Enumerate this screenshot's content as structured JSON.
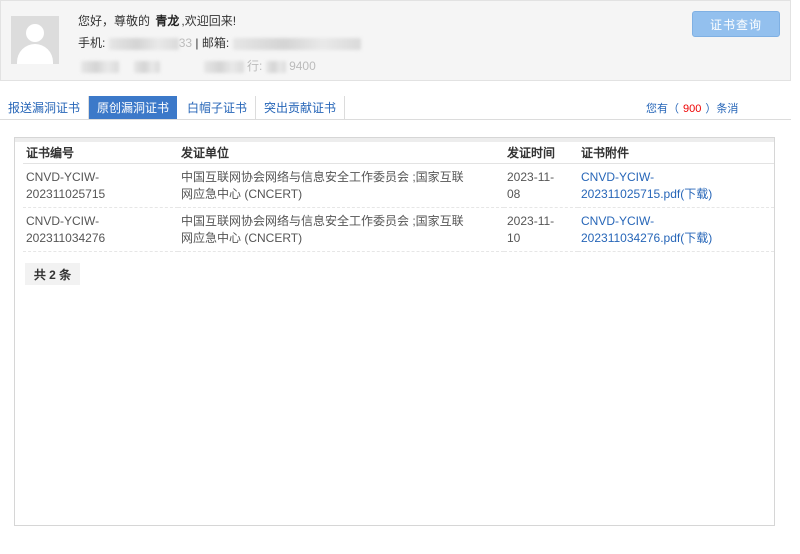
{
  "user": {
    "greeting_prefix": "您好，尊敬的",
    "name": "青龙",
    "greeting_suffix": ",欢迎回来!",
    "phone_label": "手机:",
    "phone_tail": "33",
    "separator": "| 邮箱:",
    "line3_partial": "行:",
    "line3_tail": "9400"
  },
  "header": {
    "cert_query_button": "证书查询"
  },
  "tabs": [
    {
      "label": "报送漏洞证书",
      "active": false
    },
    {
      "label": "原创漏洞证书",
      "active": true
    },
    {
      "label": "白帽子证书",
      "active": false
    },
    {
      "label": "突出贡献证书",
      "active": false
    }
  ],
  "messages": {
    "prefix": "您有（",
    "count": "900",
    "suffix": "）条消"
  },
  "table": {
    "headers": [
      "证书编号",
      "发证单位",
      "发证时间",
      "证书附件"
    ],
    "rows": [
      {
        "id_line1": "CNVD-YCIW-",
        "id_line2": "202311025715",
        "issuer_line1": "中国互联网协会网络与信息安全工作委员会 ;国家互联",
        "issuer_line2": "网应急中心 (CNCERT)",
        "date_line1": "2023-11-",
        "date_line2": "08",
        "attach_line1": "CNVD-YCIW-",
        "attach_line2": "202311025715.pdf(下载)"
      },
      {
        "id_line1": "CNVD-YCIW-",
        "id_line2": "202311034276",
        "issuer_line1": "中国互联网协会网络与信息安全工作委员会 ;国家互联",
        "issuer_line2": "网应急中心 (CNCERT)",
        "date_line1": "2023-11-",
        "date_line2": "10",
        "attach_line1": "CNVD-YCIW-",
        "attach_line2": "202311034276.pdf(下载)"
      }
    ]
  },
  "footer": {
    "total": "共 2 条"
  },
  "colors": {
    "accent": "#3c79c9",
    "button": "#93c0ee",
    "link": "#2766b8",
    "count": "#ee0000"
  }
}
